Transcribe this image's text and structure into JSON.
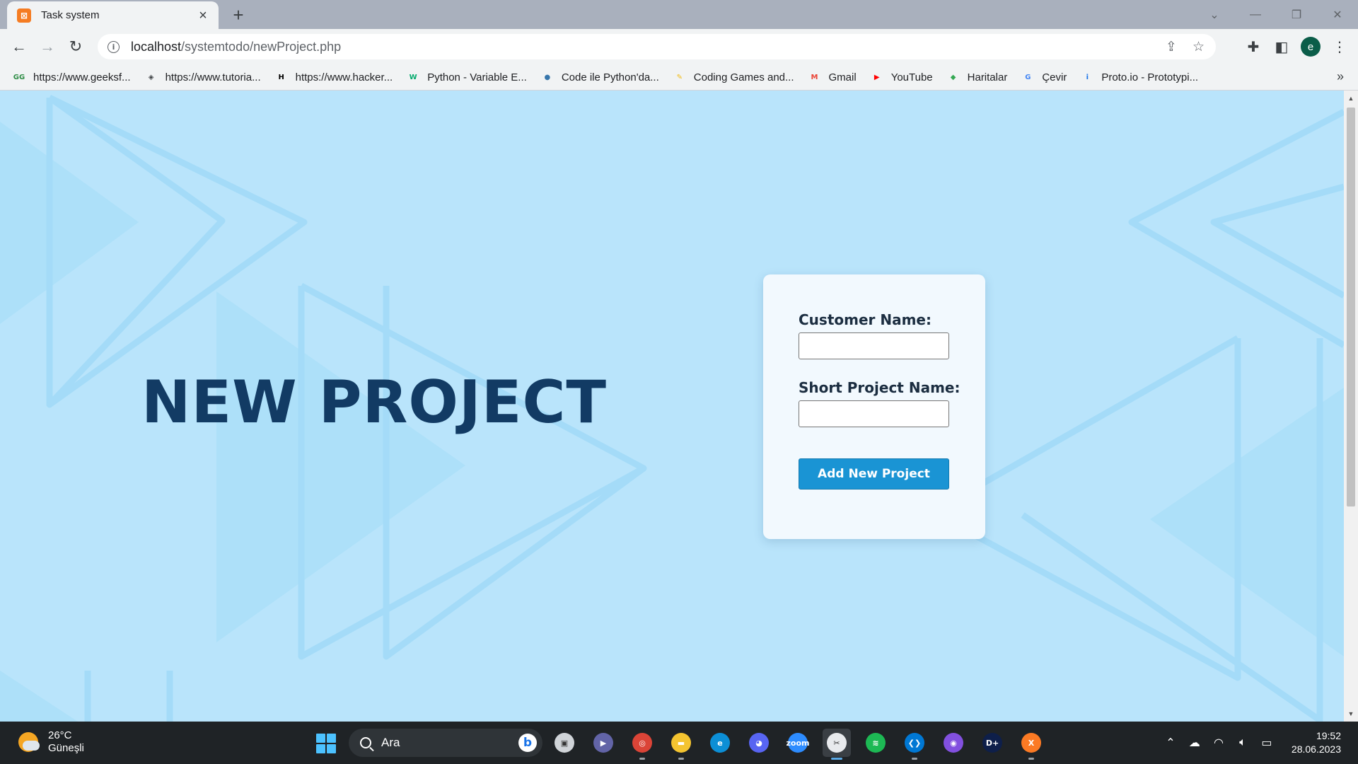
{
  "browser": {
    "tab_title": "Task system",
    "url_host": "localhost",
    "url_path": "/systemtodo/newProject.php",
    "profile_initial": "e"
  },
  "bookmarks": [
    {
      "label": "https://www.geeksf...",
      "icon": "geeksforgeeks-icon",
      "color": "#2f8d46",
      "glyph": "GG"
    },
    {
      "label": "https://www.tutoria...",
      "icon": "tutorialspoint-icon",
      "color": "#3c4043",
      "glyph": "◈"
    },
    {
      "label": "https://www.hacker...",
      "icon": "hackerrank-icon",
      "color": "#000000",
      "glyph": "H"
    },
    {
      "label": "Python - Variable E...",
      "icon": "w3schools-icon",
      "color": "#04aa6d",
      "glyph": "W"
    },
    {
      "label": "Code ile Python'da...",
      "icon": "python-icon",
      "color": "#3776ab",
      "glyph": "●"
    },
    {
      "label": "Coding Games and...",
      "icon": "codingame-icon",
      "color": "#f2bb13",
      "glyph": "✎"
    },
    {
      "label": "Gmail",
      "icon": "gmail-icon",
      "color": "#ea4335",
      "glyph": "M"
    },
    {
      "label": "YouTube",
      "icon": "youtube-icon",
      "color": "#ff0000",
      "glyph": "▶"
    },
    {
      "label": "Haritalar",
      "icon": "maps-icon",
      "color": "#34a853",
      "glyph": "◆"
    },
    {
      "label": "Çevir",
      "icon": "translate-icon",
      "color": "#4285f4",
      "glyph": "G"
    },
    {
      "label": "Proto.io - Prototypi...",
      "icon": "protoio-icon",
      "color": "#1a73e8",
      "glyph": "i"
    }
  ],
  "page": {
    "title": "NEW PROJECT",
    "form": {
      "customer_label": "Customer Name:",
      "customer_value": "",
      "project_label": "Short Project Name:",
      "project_value": "",
      "submit_label": "Add New Project"
    }
  },
  "taskbar": {
    "weather_temp": "26°C",
    "weather_desc": "Güneşli",
    "search_placeholder": "Ara",
    "apps": [
      {
        "name": "file-explorer-taskview-icon",
        "color": "#d0d4d8",
        "glyph": "▣"
      },
      {
        "name": "teams-chat-icon",
        "color": "#6264a7",
        "glyph": "▶"
      },
      {
        "name": "chrome-icon",
        "color": "#db4437",
        "glyph": "◎"
      },
      {
        "name": "file-explorer-icon",
        "color": "#f4c430",
        "glyph": "▬"
      },
      {
        "name": "edge-icon",
        "color": "#0c8fd6",
        "glyph": "e"
      },
      {
        "name": "discord-icon",
        "color": "#5865f2",
        "glyph": "◕"
      },
      {
        "name": "zoom-icon",
        "color": "#2d8cff",
        "glyph": "zoom"
      },
      {
        "name": "snipping-tool-icon",
        "color": "#e8eaed",
        "glyph": "✂"
      },
      {
        "name": "spotify-icon",
        "color": "#1db954",
        "glyph": "≋"
      },
      {
        "name": "vscode-icon",
        "color": "#0078d4",
        "glyph": "❮❯"
      },
      {
        "name": "github-icon",
        "color": "#8250df",
        "glyph": "◉"
      },
      {
        "name": "disney-plus-icon",
        "color": "#0e1f4a",
        "glyph": "D+"
      },
      {
        "name": "xampp-icon",
        "color": "#fb7a24",
        "glyph": "X"
      }
    ],
    "time": "19:52",
    "date": "28.06.2023"
  },
  "colors": {
    "page_background": "#b9e4fb",
    "title": "#123b64",
    "card": "#f2f9fe",
    "button": "#1a94d4"
  }
}
